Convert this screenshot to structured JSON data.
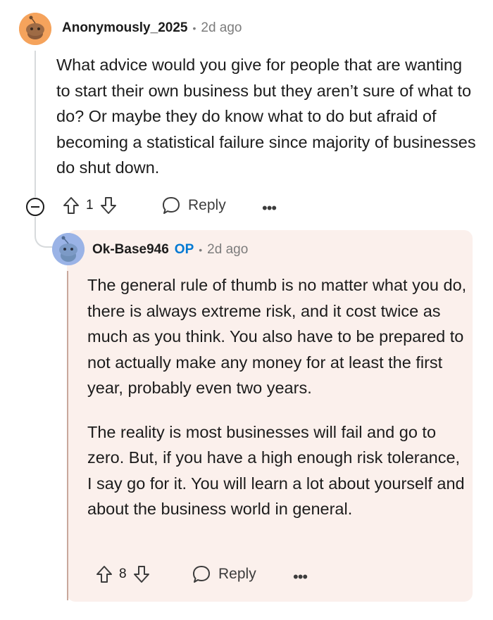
{
  "comment": {
    "author": "Anonymously_2025",
    "time": "2d ago",
    "body": "What advice would you give for people that are wanting to start their own business but they aren’t sure of what to do? Or maybe they do know what to do but afraid of becoming a statistical failure since majority of businesses do shut down.",
    "votes": "1",
    "reply_label": "Reply",
    "more_label": "•••",
    "avatar_icon": "snoo-avatar-icon",
    "avatar_color": "#f5a35c"
  },
  "reply": {
    "author": "Ok-Base946",
    "op_badge": "OP",
    "time": "2d ago",
    "paragraph_1": "The general rule of thumb is no matter what you do, there is always extreme risk, and it cost twice as much as you think. You also have to be prepared to not actually make any money for at least the first year, probably even two years.",
    "paragraph_2": "The reality is most businesses will fail and go to zero. But, if you have a high enough risk tolerance, I say go for it. You will learn a lot about yourself and about the business world in general.",
    "votes": "8",
    "reply_label": "Reply",
    "more_label": "•••",
    "avatar_icon": "snoo-avatar-icon",
    "avatar_color": "#9ab3e6"
  },
  "icons": {
    "upvote": "upvote-arrow-icon",
    "downvote": "downvote-arrow-icon",
    "reply": "speech-bubble-icon",
    "collapse": "collapse-minus-icon"
  }
}
